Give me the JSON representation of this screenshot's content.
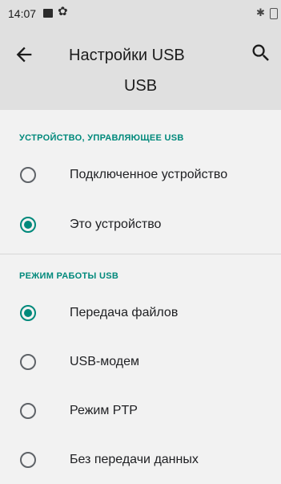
{
  "status_bar": {
    "time": "14:07"
  },
  "app_bar": {
    "title": "Настройки USB",
    "subtitle": "USB"
  },
  "sections": [
    {
      "header": "УСТРОЙСТВО, УПРАВЛЯЮЩЕЕ USB",
      "options": [
        {
          "label": "Подключенное устройство",
          "checked": false
        },
        {
          "label": "Это устройство",
          "checked": true
        }
      ]
    },
    {
      "header": "РЕЖИМ РАБОТЫ USB",
      "options": [
        {
          "label": "Передача файлов",
          "checked": true
        },
        {
          "label": "USB-модем",
          "checked": false
        },
        {
          "label": "Режим PTP",
          "checked": false
        },
        {
          "label": "Без передачи данных",
          "checked": false
        }
      ]
    }
  ],
  "colors": {
    "accent": "#00897b",
    "app_bar_bg": "#e0e0e0",
    "page_bg": "#f2f2f2"
  },
  "icons": [
    "image-icon",
    "gear-icon",
    "bluetooth-icon",
    "battery-icon",
    "back-arrow-icon",
    "search-icon"
  ]
}
